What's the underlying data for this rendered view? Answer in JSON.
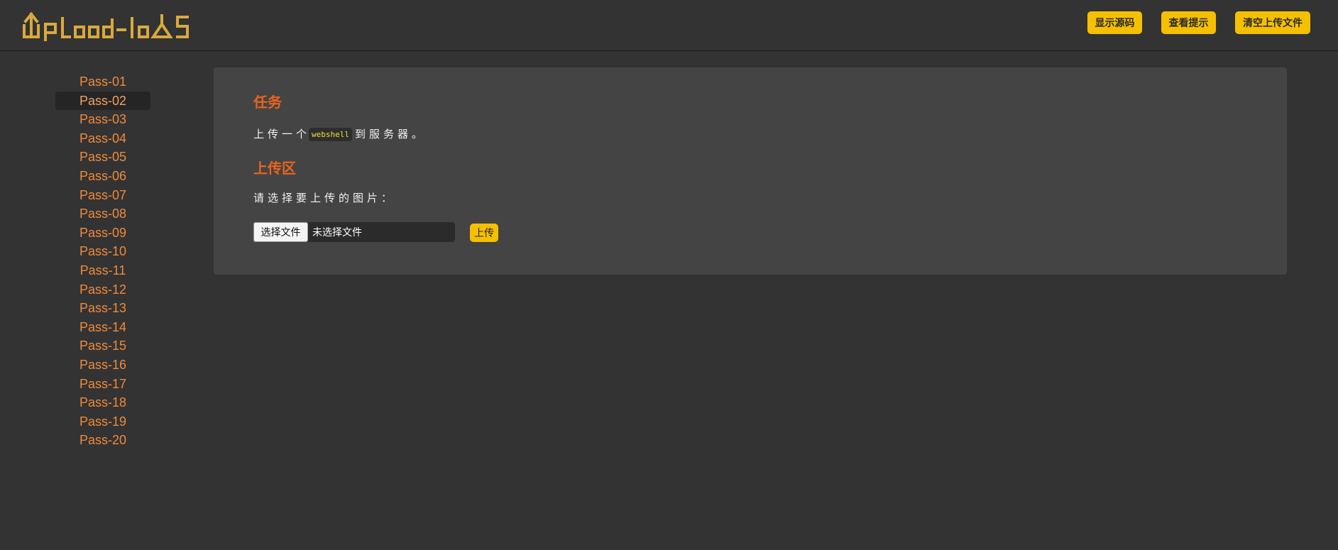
{
  "header": {
    "logo_text": "UpLoad-labS",
    "buttons": {
      "show_source": "显示源码",
      "view_hint": "查看提示",
      "clear_uploads": "清空上传文件"
    }
  },
  "sidebar": {
    "active": "Pass-02",
    "items": [
      "Pass-01",
      "Pass-02",
      "Pass-03",
      "Pass-04",
      "Pass-05",
      "Pass-06",
      "Pass-07",
      "Pass-08",
      "Pass-09",
      "Pass-10",
      "Pass-11",
      "Pass-12",
      "Pass-13",
      "Pass-14",
      "Pass-15",
      "Pass-16",
      "Pass-17",
      "Pass-18",
      "Pass-19",
      "Pass-20"
    ]
  },
  "task": {
    "title": "任务",
    "text_before": "上传一个",
    "code": "webshell",
    "text_after": "到服务器。"
  },
  "upload": {
    "title": "上传区",
    "prompt": "请选择要上传的图片：",
    "choose_button": "选择文件",
    "file_status": "未选择文件",
    "submit_label": "上传"
  },
  "colors": {
    "background": "#333333",
    "panel": "#444444",
    "accent_yellow": "#f5c000",
    "heading_orange": "#e8641c",
    "link_orange": "#f08a3a",
    "code_yellow": "#e8e040"
  }
}
